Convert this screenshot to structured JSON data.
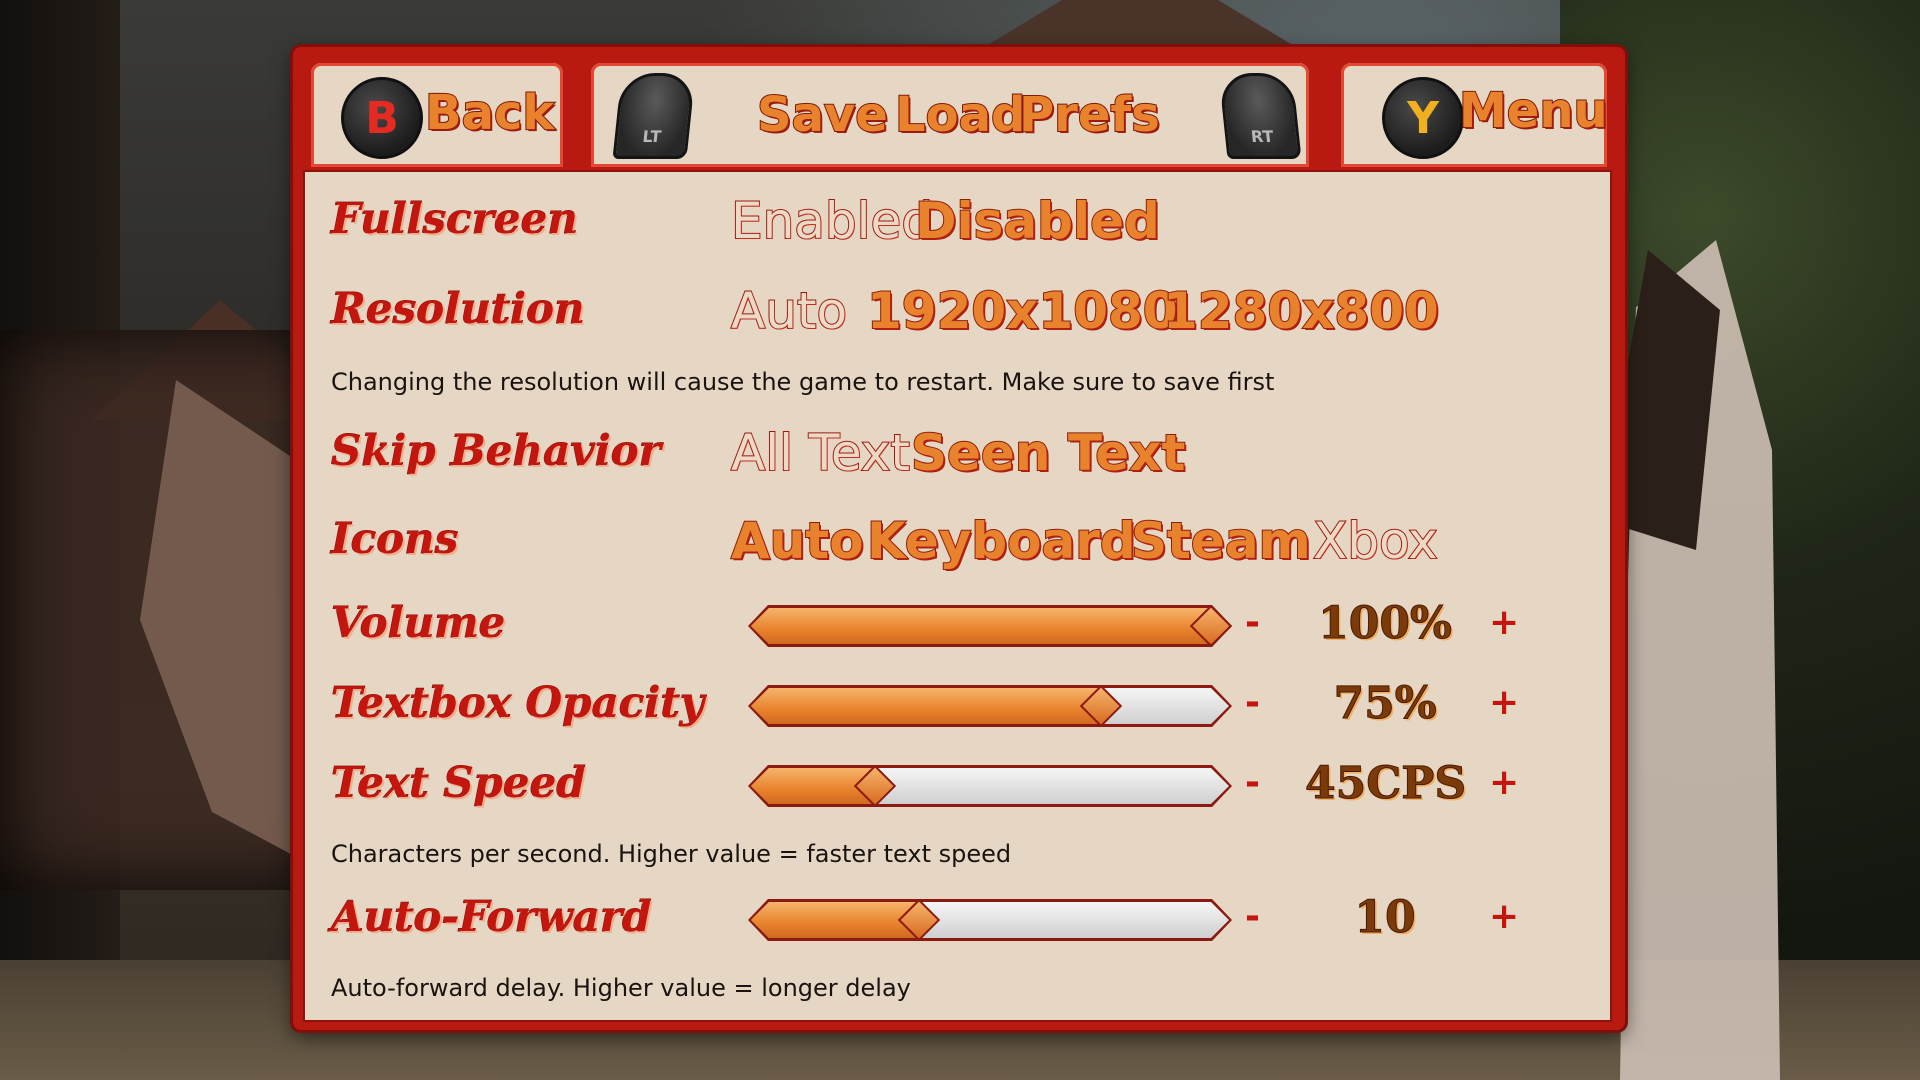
{
  "nav": {
    "back_button_glyph": "B",
    "back_label": "Back",
    "lt_label": "LT",
    "save_label": "Save",
    "load_label": "Load",
    "prefs_label": "Prefs",
    "rt_label": "RT",
    "menu_button_glyph": "Y",
    "menu_label": "Menu"
  },
  "settings": {
    "fullscreen": {
      "label": "Fullscreen",
      "options": [
        "Enabled",
        "Disabled"
      ],
      "selected": "Enabled"
    },
    "resolution": {
      "label": "Resolution",
      "options": [
        "Auto",
        "1920x1080",
        "1280x800"
      ],
      "selected": "Auto",
      "hint": "Changing the resolution will cause the game to restart. Make sure to save first"
    },
    "skip": {
      "label": "Skip Behavior",
      "options": [
        "All Text",
        "Seen Text"
      ],
      "selected": "All Text"
    },
    "icons": {
      "label": "Icons",
      "options": [
        "Auto",
        "Keyboard",
        "Steam",
        "Xbox"
      ],
      "selected": "Xbox"
    },
    "volume": {
      "label": "Volume",
      "value_text": "100%",
      "level": 1.0
    },
    "opacity": {
      "label": "Textbox Opacity",
      "value_text": "75%",
      "level": 0.75
    },
    "speed": {
      "label": "Text Speed",
      "value_text": "45CPS",
      "level": 0.24,
      "hint": "Characters per second. Higher value = faster text speed"
    },
    "autofwd": {
      "label": "Auto-Forward",
      "value_text": "10",
      "level": 0.34,
      "hint": "Auto-forward delay. Higher value = longer delay"
    }
  },
  "controls": {
    "minus": "-",
    "plus": "+"
  },
  "colors": {
    "panel_red": "#b81a12",
    "option_orange": "#e8822c",
    "content_bg": "#e6d7c5"
  }
}
